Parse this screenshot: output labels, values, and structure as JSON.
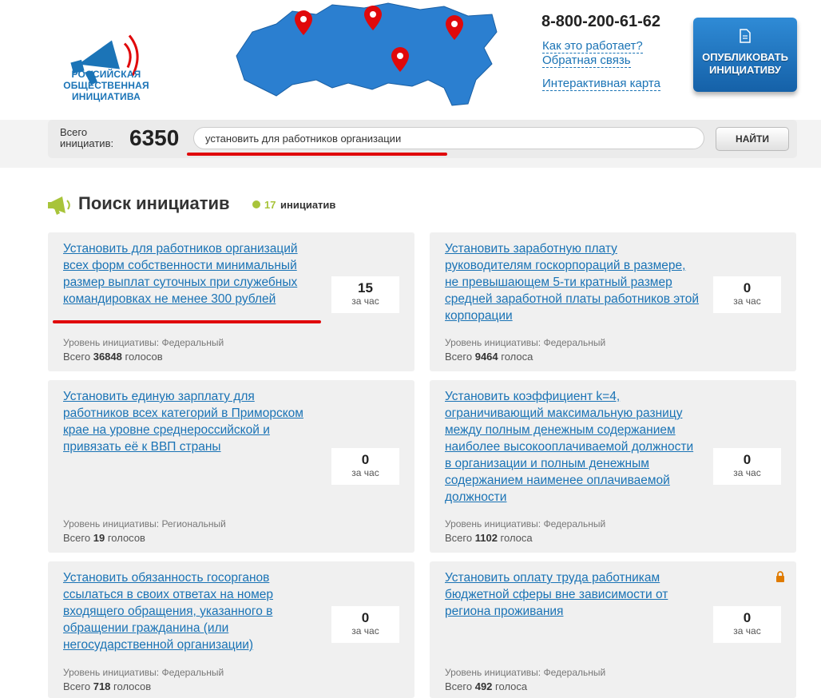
{
  "logo": {
    "lines": [
      "РОССИЙСКАЯ",
      "ОБЩЕСТВЕННАЯ",
      "ИНИЦИАТИВА"
    ]
  },
  "header": {
    "phone": "8-800-200-61-62",
    "links": [
      "Как это работает?",
      "Обратная связь",
      "Интерактивная карта"
    ],
    "publish_button": [
      "ОПУБЛИКОВАТЬ",
      "ИНИЦИАТИВУ"
    ]
  },
  "search": {
    "total_label_1": "Всего",
    "total_label_2": "инициатив:",
    "total_count": "6350",
    "query": "установить для работников организации",
    "button": "НАЙТИ"
  },
  "results": {
    "title": "Поиск инициатив",
    "count": "17",
    "count_word": "инициатив"
  },
  "cards": [
    {
      "title": "Установить для работников организаций всех форм собственности минимальный размер выплат суточных при служебных командировках не менее 300 рублей",
      "votes": "15",
      "votes_unit": "за час",
      "level": "Уровень инициативы: Федеральный",
      "total_prefix": "Всего",
      "total_votes": "36848",
      "total_suffix": "голосов"
    },
    {
      "title": "Установить заработную плату руководителям госкорпораций в размере, не превышающем 5-ти кратный размер средней заработной платы работников этой корпорации",
      "votes": "0",
      "votes_unit": "за час",
      "level": "Уровень инициативы: Федеральный",
      "total_prefix": "Всего",
      "total_votes": "9464",
      "total_suffix": "голоса"
    },
    {
      "title": "Установить единую зарплату для работников всех категорий в Приморском крае на уровне среднероссийской и привязать её к ВВП страны",
      "votes": "0",
      "votes_unit": "за час",
      "level": "Уровень инициативы: Региональный",
      "total_prefix": "Всего",
      "total_votes": "19",
      "total_suffix": "голосов"
    },
    {
      "title": "Установить коэффициент k=4, ограничивающий максимальную разницу между полным денежным содержанием наиболее высокооплачиваемой должности в организации и полным денежным содержанием наименее оплачиваемой должности",
      "votes": "0",
      "votes_unit": "за час",
      "level": "Уровень инициативы: Федеральный",
      "total_prefix": "Всего",
      "total_votes": "1102",
      "total_suffix": "голоса"
    },
    {
      "title": "Установить обязанность госорганов ссылаться в своих ответах на номер входящего обращения, указанного в обращении гражданина (или негосударственной организации)",
      "votes": "0",
      "votes_unit": "за час",
      "level": "Уровень инициативы: Федеральный",
      "total_prefix": "Всего",
      "total_votes": "718",
      "total_suffix": "голосов"
    },
    {
      "title": "Установить оплату труда работникам бюджетной сферы вне зависимости от региона проживания",
      "votes": "0",
      "votes_unit": "за час",
      "level": "Уровень инициативы: Федеральный",
      "total_prefix": "Всего",
      "total_votes": "492",
      "total_suffix": "голоса"
    }
  ],
  "colors": {
    "brand_blue": "#1b74b7",
    "link": "#1a73b5",
    "highlight_red": "#e0090b",
    "accent_green": "#a8c43a"
  },
  "icons": [
    "megaphone-logo-icon",
    "russia-map-icon",
    "map-pin-icon",
    "document-icon",
    "megaphone-icon",
    "lock-icon"
  ]
}
